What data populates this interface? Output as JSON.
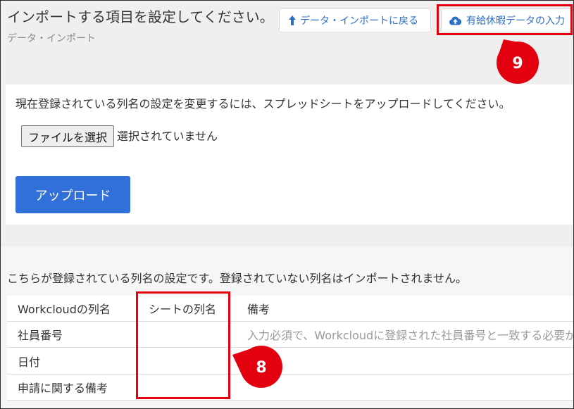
{
  "header": {
    "title": "インポートする項目を設定してください。",
    "subtitle": "データ・インポート",
    "back_button": {
      "label": "データ・インポートに戻る",
      "icon": "arrow-up-icon"
    },
    "paid_leave_button": {
      "label": "有給休暇データの入力",
      "icon": "cloud-upload-icon"
    }
  },
  "upload_panel": {
    "instruction": "現在登録されている列名の設定を変更するには、スプレッドシートをアップロードしてください。",
    "file_input": {
      "button_label": "ファイルを選択",
      "status": "選択されていません"
    },
    "upload_button_label": "アップロード"
  },
  "mapping": {
    "description": "こちらが登録されている列名の設定です。登録されていない列名はインポートされません。",
    "columns": [
      "Workcloudの列名",
      "シートの列名",
      "備考"
    ],
    "rows": [
      {
        "workcloud_column": "社員番号",
        "note": "入力必須で、Workcloudに登録された社員番号と一致する必要が"
      },
      {
        "workcloud_column": "日付"
      },
      {
        "workcloud_column": "申請に関する備考"
      }
    ]
  },
  "annotations": [
    {
      "number": "9"
    },
    {
      "number": "8"
    }
  ],
  "colors": {
    "accent_blue": "#3070d8",
    "link_blue": "#2d6fc7",
    "annotation_red": "#e3000f",
    "page_background": "#efefef"
  }
}
